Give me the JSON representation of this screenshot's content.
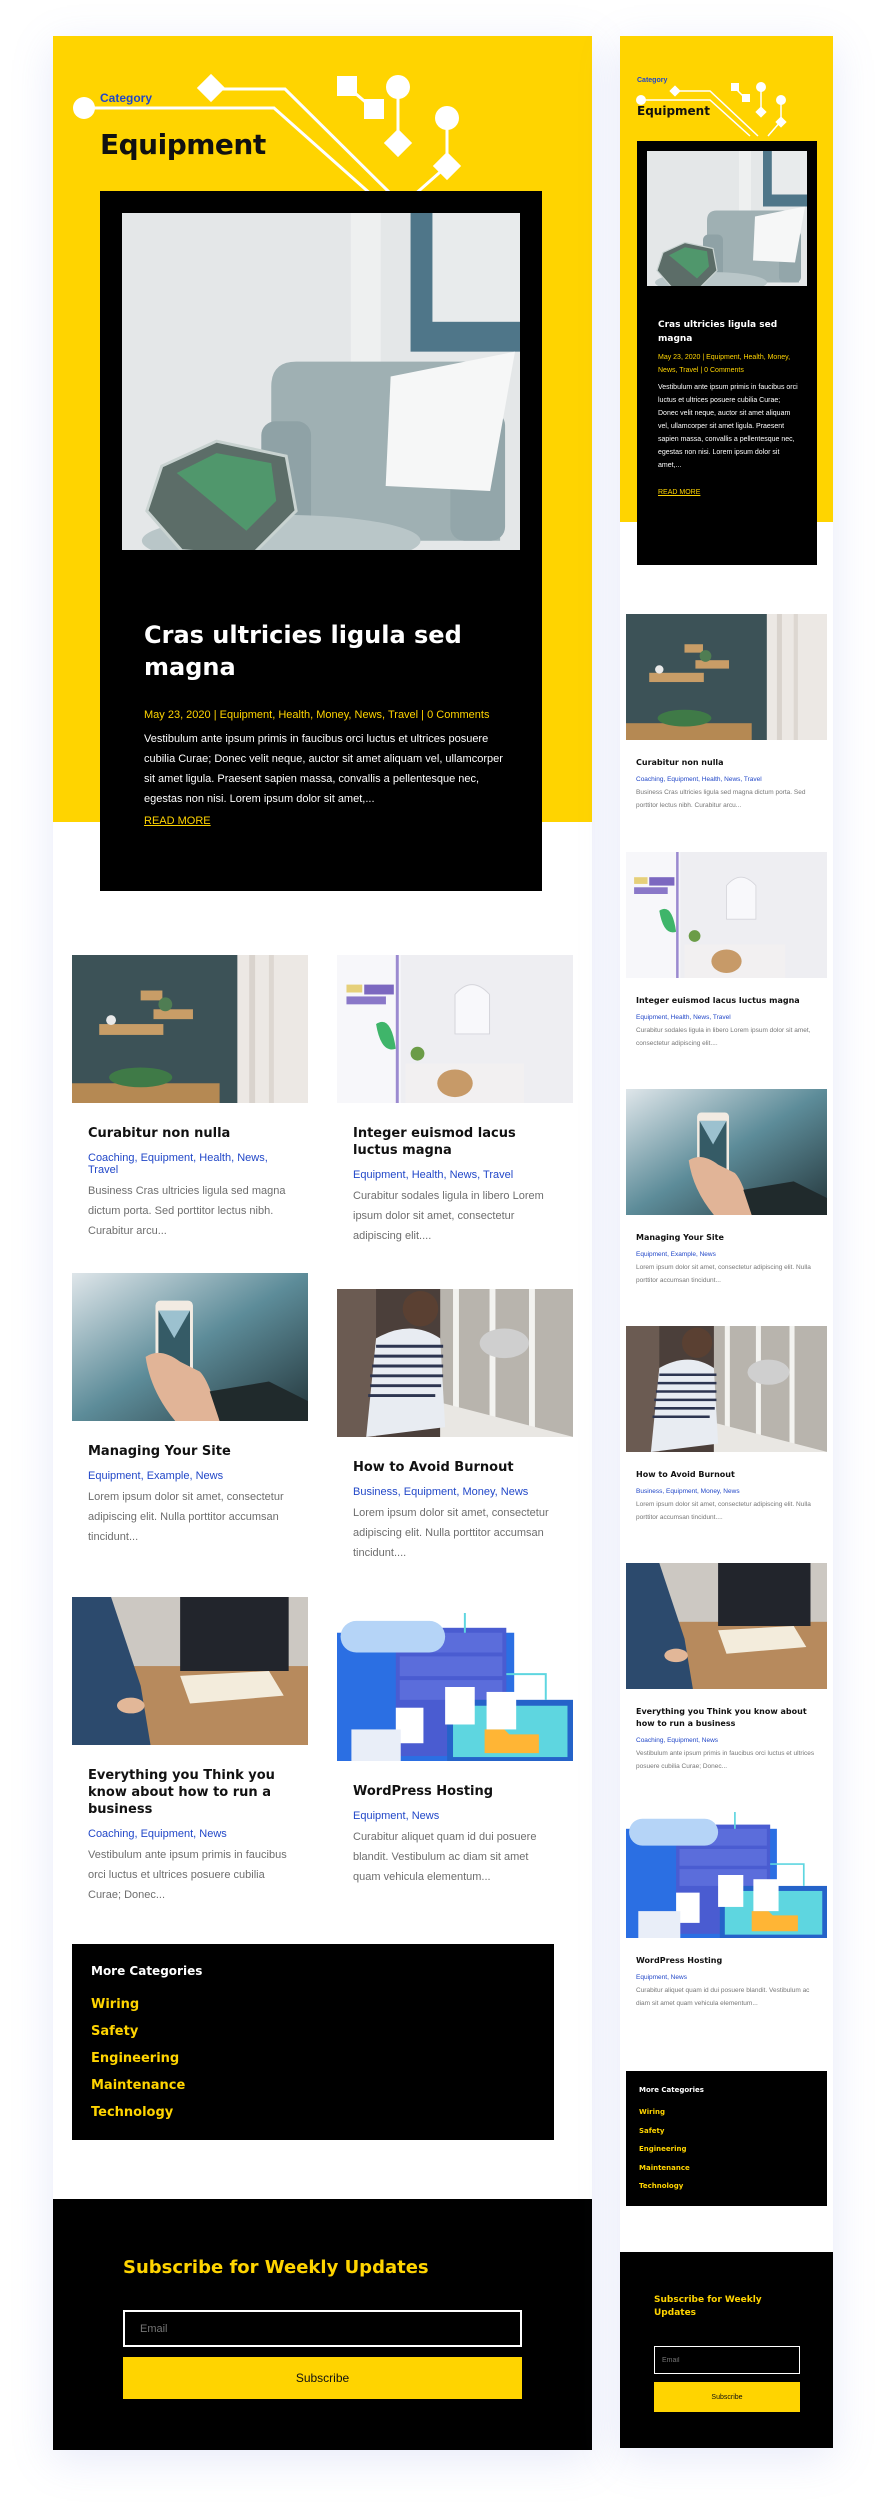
{
  "colors": {
    "accent": "#ffd400",
    "link": "#2147c8",
    "dark": "#000000",
    "text": "#111111",
    "muted": "#6e6e6e"
  },
  "header": {
    "category_label": "Category",
    "title": "Equipment"
  },
  "featured": {
    "image": "armchair-terrarium-photo",
    "title": "Cras ultricies ligula sed magna",
    "meta": "May 23, 2020 | Equipment, Health, Money, News, Travel | 0 Comments",
    "excerpt": "Vestibulum ante ipsum primis in faucibus orci luctus et ultrices posuere cubilia Curae; Donec velit neque, auctor sit amet aliquam vel, ullamcorper sit amet ligula. Praesent sapien massa, convallis a pellentesque nec, egestas non nisi. Lorem ipsum dolor sit amet,...",
    "read_more": "READ MORE"
  },
  "posts": [
    {
      "image": "wall-shelves-photo",
      "title": "Curabitur non nulla",
      "categories": "Coaching, Equipment, Health, News, Travel",
      "excerpt": "Business Cras ultricies ligula sed magna dictum porta. Sed porttitor lectus nibh. Curabitur arcu..."
    },
    {
      "image": "bright-room-photo",
      "title": "Integer euismod lacus luctus magna",
      "categories": "Equipment, Health, News, Travel",
      "excerpt": "Curabitur sodales ligula in libero Lorem ipsum dolor sit amet, consectetur adipiscing elit...."
    },
    {
      "image": "phone-in-hand-photo",
      "title": "Managing Your Site",
      "categories": "Equipment, Example, News",
      "excerpt": "Lorem ipsum dolor sit amet, consectetur adipiscing elit. Nulla porttitor accumsan tincidunt..."
    },
    {
      "image": "woman-at-window-photo",
      "title": "How to Avoid Burnout",
      "categories": "Business, Equipment, Money, News",
      "excerpt": "Lorem ipsum dolor sit amet, consectetur adipiscing elit. Nulla porttitor accumsan tincidunt...."
    },
    {
      "image": "business-meeting-photo",
      "title": "Everything you Think you know about how to run a business",
      "categories": "Coaching, Equipment, News",
      "excerpt": "Vestibulum ante ipsum primis in faucibus orci luctus et ultrices posuere cubilia Curae; Donec..."
    },
    {
      "image": "hosting-illustration",
      "title": "WordPress Hosting",
      "categories": "Equipment, News",
      "excerpt": "Curabitur aliquet quam id dui posuere blandit. Vestibulum ac diam sit amet quam vehicula elementum..."
    }
  ],
  "more_categories": {
    "heading": "More Categories",
    "items": [
      "Wiring",
      "Safety",
      "Engineering",
      "Maintenance",
      "Technology"
    ]
  },
  "subscribe": {
    "heading": "Subscribe for Weekly Updates",
    "email_placeholder": "Email",
    "button_label": "Subscribe"
  }
}
